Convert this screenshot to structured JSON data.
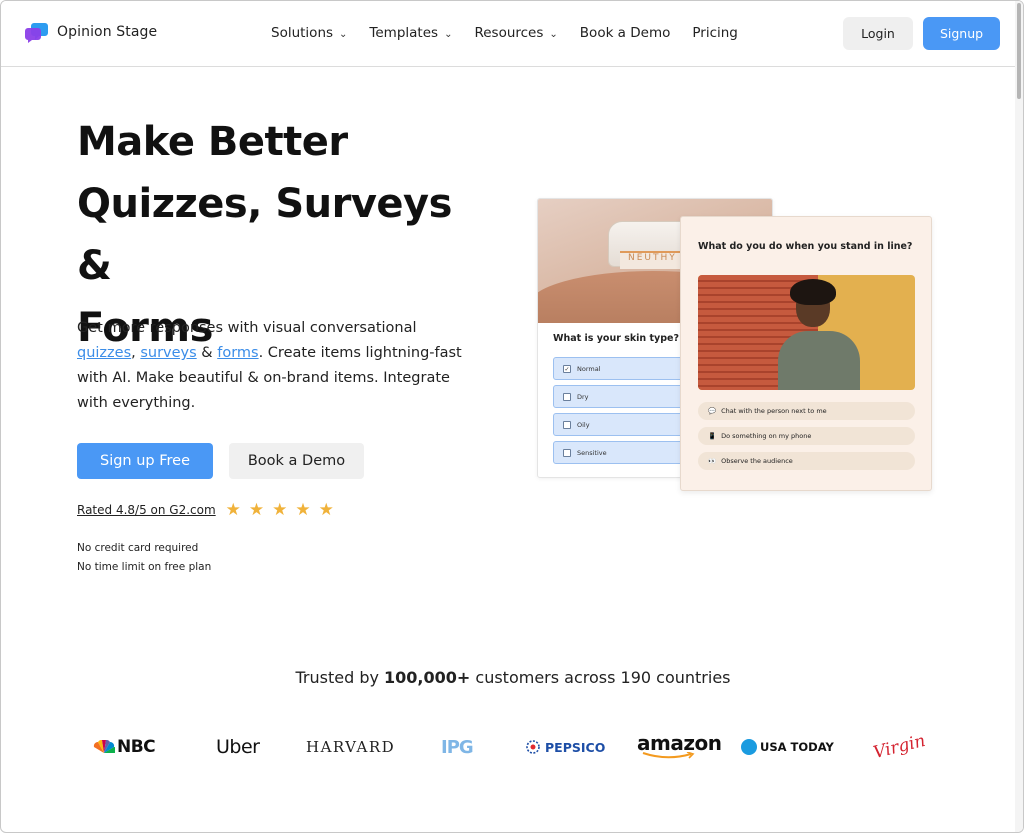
{
  "header": {
    "logo_text": "Opinion Stage",
    "nav": [
      {
        "label": "Solutions",
        "has_dropdown": true
      },
      {
        "label": "Templates",
        "has_dropdown": true
      },
      {
        "label": "Resources",
        "has_dropdown": true
      },
      {
        "label": "Book a Demo",
        "has_dropdown": false
      },
      {
        "label": "Pricing",
        "has_dropdown": false
      }
    ],
    "login_label": "Login",
    "signup_label": "Signup"
  },
  "hero": {
    "title_lines": [
      "Make Better",
      "Quizzes, Surveys &",
      "Forms"
    ],
    "desc_part1": "Get more responses with visual conversational ",
    "link_quizzes": "quizzes",
    "desc_comma": ", ",
    "link_surveys": "surveys",
    "desc_amp": " & ",
    "link_forms": "forms",
    "desc_part2": ". Create items lightning-fast with AI. Make beautiful & on-brand items. Integrate with everything.",
    "cta_primary": "Sign up Free",
    "cta_secondary": "Book a Demo",
    "rating_text": "Rated 4.8/5 on G2.com",
    "stars": 5,
    "note_1": "No credit card required",
    "note_2": "No time limit on free plan"
  },
  "preview": {
    "jar_label": "NEUTHY",
    "card_a_question": "What is your skin type?",
    "card_a_options": [
      {
        "label": "Normal",
        "checked": true
      },
      {
        "label": "Dry",
        "checked": false
      },
      {
        "label": "Oily",
        "checked": false
      },
      {
        "label": "Sensitive",
        "checked": false
      }
    ],
    "card_b_question": "What do you do when you stand in line?",
    "card_b_answers": [
      {
        "icon": "💬",
        "label": "Chat with the person next to me"
      },
      {
        "icon": "📱",
        "label": "Do something on my phone"
      },
      {
        "icon": "👀",
        "label": "Observe the audience"
      }
    ]
  },
  "trusted": {
    "prefix": "Trusted by ",
    "count": "100,000+",
    "suffix": " customers across 190 countries"
  },
  "brands": {
    "nbc": "NBC",
    "uber": "Uber",
    "harvard": "HARVARD",
    "ipg": "IPG",
    "pepsico": "PEPSICO",
    "amazon": "amazon",
    "usatoday": "USA TODAY",
    "virgin": "Virgin"
  },
  "colors": {
    "accent": "#4a98f5",
    "link": "#3b8de8",
    "star": "#f0b23a"
  }
}
